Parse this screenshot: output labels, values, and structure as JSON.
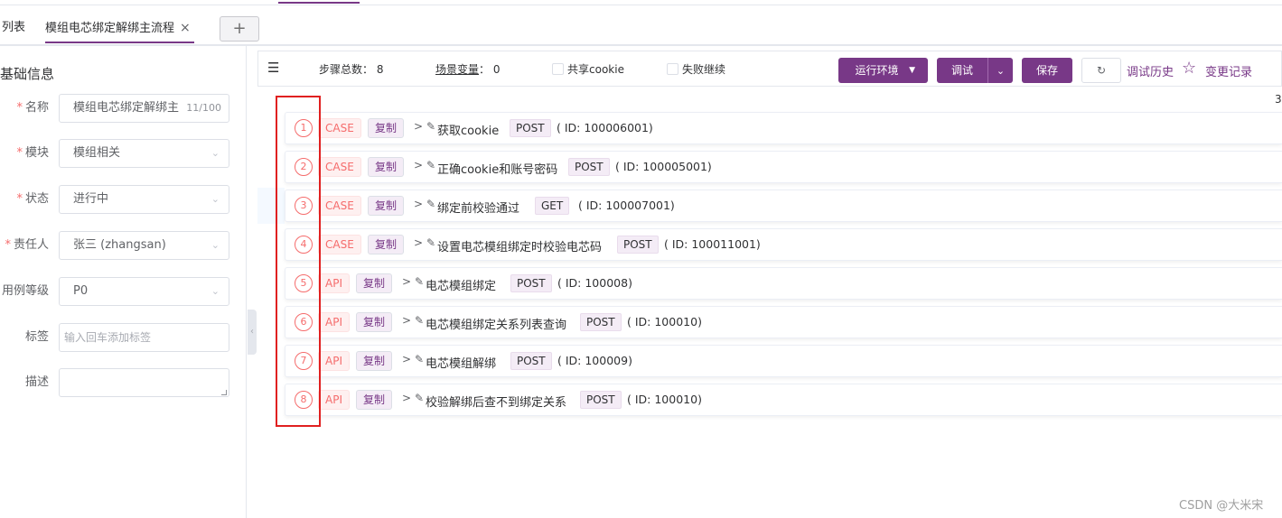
{
  "tabs": {
    "list_tab": "列表",
    "active_tab": "模组电芯绑定解绑主流程",
    "close_glyph": "×",
    "add_glyph": "+"
  },
  "form": {
    "section_title": "基础信息",
    "name": {
      "label": "名称",
      "value": "模组电芯绑定解绑主",
      "count": "11/100"
    },
    "module": {
      "label": "模块",
      "value": "模组相关"
    },
    "status": {
      "label": "状态",
      "value": "进行中"
    },
    "owner": {
      "label": "责任人",
      "value": "张三 (zhangsan)"
    },
    "level": {
      "label": "用例等级",
      "value": "P0"
    },
    "tags": {
      "label": "标签",
      "placeholder": "输入回车添加标签"
    },
    "desc": {
      "label": "描述",
      "value": ""
    }
  },
  "toolbar": {
    "steps_total_label": "步骤总数：",
    "steps_total_value": "8",
    "scene_vars_label": "场景变量",
    "scene_vars_value": "： 0",
    "share_cookie": "共享cookie",
    "fail_continue": "失败继续",
    "env_button": "运行环境",
    "debug_button": "调试",
    "save_button": "保存",
    "debug_history": "调试历史",
    "change_log": "变更记录"
  },
  "page_indicator": "3",
  "steps": [
    {
      "num": "1",
      "type": "CASE",
      "copy": "复制",
      "name": "获取cookie",
      "method": "POST",
      "id": "( ID: 100006001)"
    },
    {
      "num": "2",
      "type": "CASE",
      "copy": "复制",
      "name": "正确cookie和账号密码",
      "method": "POST",
      "id": "( ID: 100005001)"
    },
    {
      "num": "3",
      "type": "CASE",
      "copy": "复制",
      "name": "绑定前校验通过",
      "method": "GET",
      "id": "( ID: 100007001)"
    },
    {
      "num": "4",
      "type": "CASE",
      "copy": "复制",
      "name": "设置电芯模组绑定时校验电芯码",
      "method": "POST",
      "id": "( ID: 100011001)"
    },
    {
      "num": "5",
      "type": "API",
      "copy": "复制",
      "name": "电芯模组绑定",
      "method": "POST",
      "id": "( ID: 100008)"
    },
    {
      "num": "6",
      "type": "API",
      "copy": "复制",
      "name": "电芯模组绑定关系列表查询",
      "method": "POST",
      "id": "( ID: 100010)"
    },
    {
      "num": "7",
      "type": "API",
      "copy": "复制",
      "name": "电芯模组解绑",
      "method": "POST",
      "id": "( ID: 100009)"
    },
    {
      "num": "8",
      "type": "API",
      "copy": "复制",
      "name": "校验解绑后查不到绑定关系",
      "method": "POST",
      "id": "( ID: 100010)"
    }
  ],
  "watermark": "CSDN @大米宋",
  "colors": {
    "accent": "#783887",
    "danger": "#f56c6c",
    "annotation": "#e02020"
  }
}
